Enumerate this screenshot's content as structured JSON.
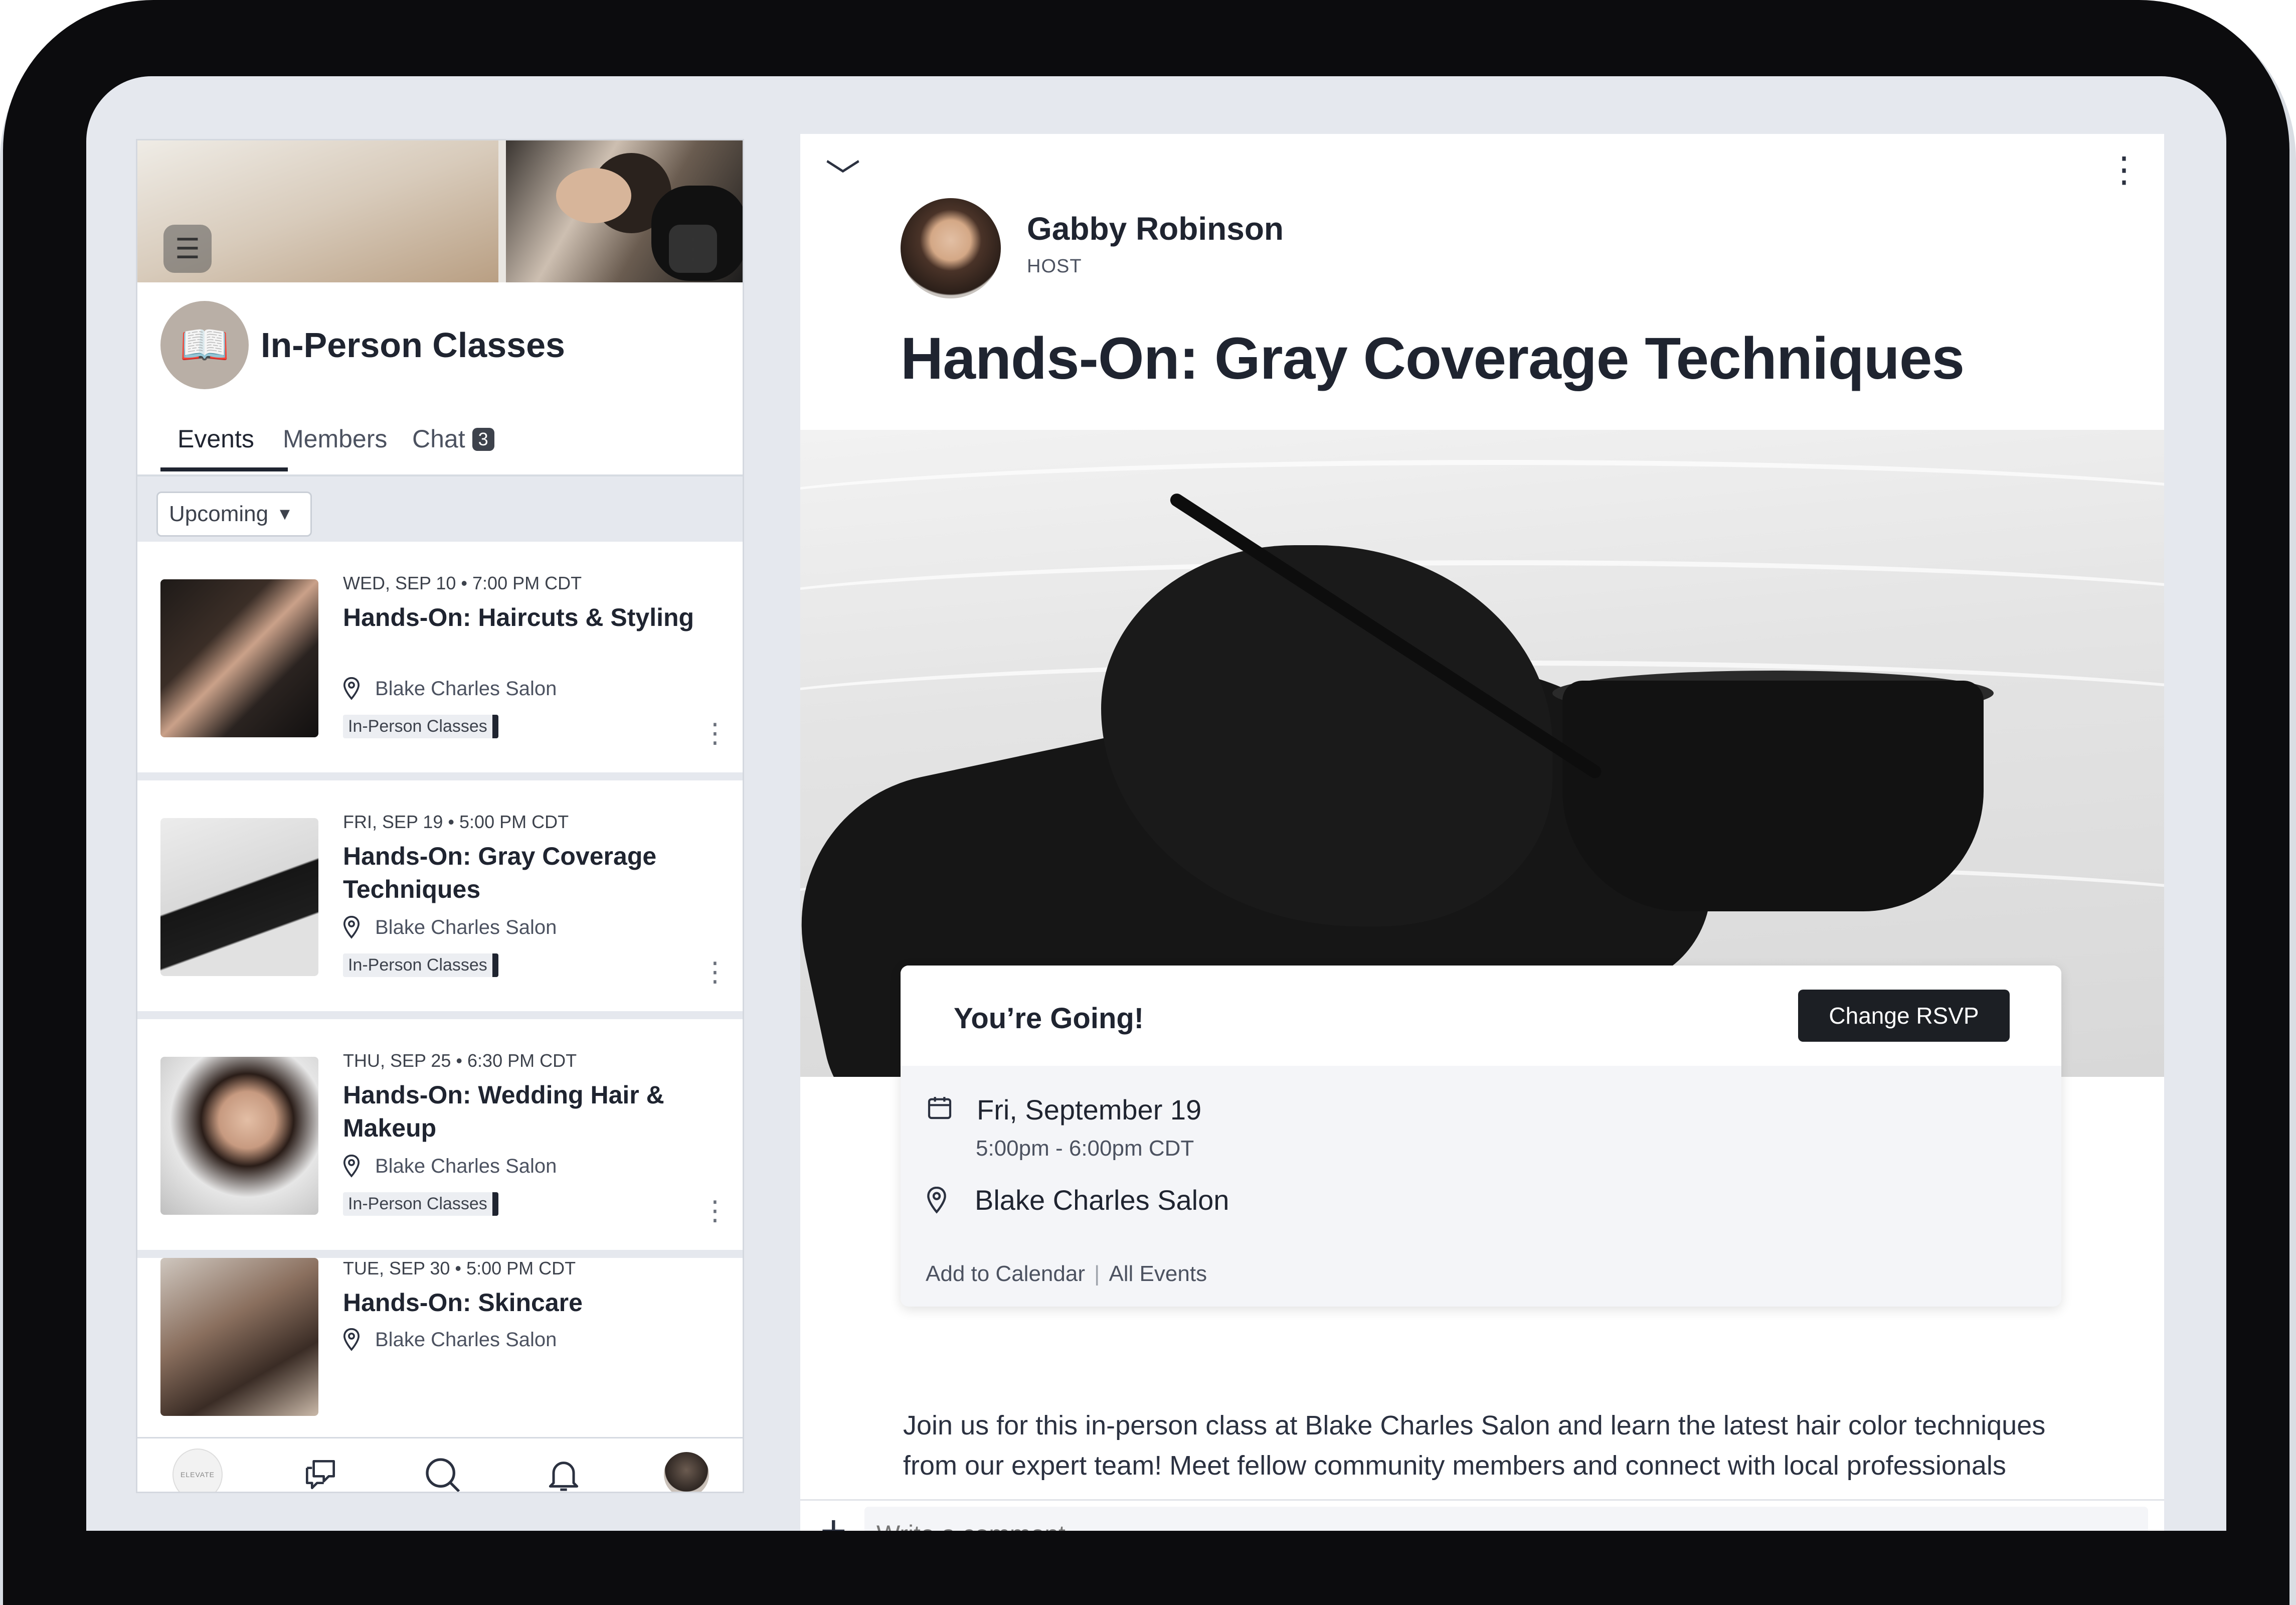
{
  "group": {
    "title": "In-Person Classes",
    "tabs": [
      {
        "label": "Events"
      },
      {
        "label": "Members"
      },
      {
        "label": "Chat",
        "badge": "3"
      }
    ],
    "filter": "Upcoming"
  },
  "events": [
    {
      "date": "WED, SEP 10 • 7:00 PM CDT",
      "title": "Hands-On: Haircuts & Styling",
      "location": "Blake Charles Salon",
      "tag": "In-Person Classes"
    },
    {
      "date": "FRI, SEP 19 • 5:00 PM CDT",
      "title": "Hands-On: Gray Coverage Techniques",
      "location": "Blake Charles Salon",
      "tag": "In-Person Classes"
    },
    {
      "date": "THU, SEP 25 • 6:30 PM CDT",
      "title": "Hands-On: Wedding Hair & Makeup",
      "location": "Blake Charles Salon",
      "tag": "In-Person Classes"
    },
    {
      "date": "TUE, SEP 30 • 5:00 PM CDT",
      "title": "Hands-On: Skincare",
      "location": "Blake Charles Salon"
    }
  ],
  "bottom_nav": {
    "logo_text": "ELEVATE",
    "icons": [
      "home-logo",
      "chat-icon",
      "search-icon",
      "bell-icon",
      "profile-avatar"
    ]
  },
  "detail": {
    "host_name": "Gabby Robinson",
    "host_role": "HOST",
    "title": "Hands-On: Gray Coverage Techniques",
    "rsvp_status": "You’re Going!",
    "change_rsvp": "Change RSVP",
    "date": "Fri, September 19",
    "time": "5:00pm - 6:00pm CDT",
    "location": "Blake Charles Salon",
    "add_to_calendar": "Add to Calendar",
    "all_events": "All Events",
    "description": "Join us for this in-person class at Blake Charles Salon and learn the latest hair color techniques from our expert team! Meet fellow community members and connect with local professionals",
    "comment_placeholder": "Write a comment..."
  },
  "colors": {
    "bezel": "#0c0c0e",
    "screen_bg": "#e5e8ee",
    "text_primary": "#1f2430",
    "button_dark": "#1c1f24"
  }
}
